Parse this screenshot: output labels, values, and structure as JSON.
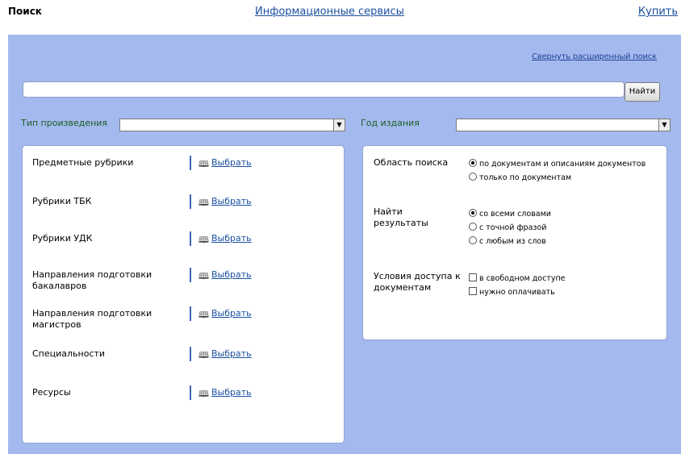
{
  "header": {
    "search_label": "Поиск",
    "services_link": "Информационные сервисы",
    "buy_link": "Купить"
  },
  "search": {
    "collapse_link": "Свернуть расширенный поиск",
    "query_value": "",
    "find_button": "Найти"
  },
  "filters": {
    "work_type_label": "Тип произведения",
    "work_type_value": "",
    "year_label": "Год издания",
    "year_value": ""
  },
  "rubrics": {
    "choose_label": "Выбрать",
    "items": [
      {
        "label": "Предметные рубрики"
      },
      {
        "label": "Рубрики ТБК"
      },
      {
        "label": "Рубрики УДК"
      },
      {
        "label": "Направления подготовки бакалавров"
      },
      {
        "label": "Направления подготовки магистров"
      },
      {
        "label": "Специальности"
      },
      {
        "label": "Ресурсы"
      }
    ]
  },
  "options": {
    "scope": {
      "label": "Область поиска",
      "choices": [
        "по документам и описаниям документов",
        "только по документам"
      ],
      "selected": 0
    },
    "results": {
      "label": "Найти результаты",
      "choices": [
        "со всеми словами",
        "с точной фразой",
        "с любым из слов"
      ],
      "selected": 0
    },
    "access": {
      "label": "Условия доступа к документам",
      "choices": [
        "в свободном доступе",
        "нужно оплачивать"
      ]
    }
  },
  "icons": {
    "book": "book-icon",
    "dropdown": "chevron-down-icon"
  },
  "colors": {
    "panel_bg": "#a4b9ee",
    "link": "#1a4fa0",
    "field_label": "#1a5e22"
  }
}
